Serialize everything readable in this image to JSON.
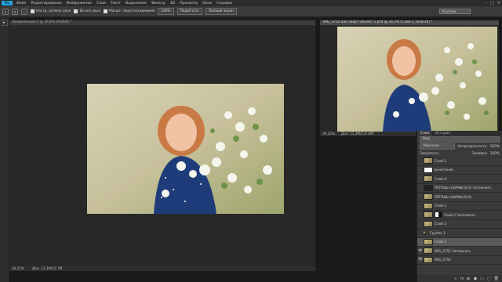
{
  "app": {
    "logo": "Ps"
  },
  "menu": [
    "Файл",
    "Редактирование",
    "Изображение",
    "Слои",
    "Текст",
    "Выделение",
    "Фильтр",
    "3D",
    "Просмотр",
    "Окно",
    "Справка"
  ],
  "window_controls": {
    "min": "–",
    "max": "□",
    "close": "✕"
  },
  "options": {
    "zoom_in": "+",
    "zoom_out": "−",
    "resize_windows": "Настр. размер окон",
    "all_windows": "Во все окна",
    "scrubby_zoom": "Масшт. перетаскиванием",
    "zoom_pct": "100%",
    "fit_screen": "Подогнать",
    "fill_screen": "Полный экран",
    "workspace": "Коллаж"
  },
  "toolbar": {
    "arrow": "▸"
  },
  "doc1": {
    "tab": "Безымянный-1 @ 36,2% (RGB/8) *",
    "zoom": "36,22%",
    "size": "Док: 11,3М/22,7М"
  },
  "doc2": {
    "tab": "IMG_3752 как смарт-объект-1.psd @ 36,2% (Слой 1, RGB/16) *",
    "zoom": "36,22%",
    "size": "Док: 11,3М/237,6М"
  },
  "layers_panel": {
    "tabs": [
      "Слои",
      "История"
    ],
    "kind": "Вид",
    "blend": "Обычные",
    "opacity_label": "Непрозрачность:",
    "opacity": "100%",
    "lock_label": "Закрепить:",
    "fill_label": "Заливка:",
    "fill": "100%",
    "layers": [
      {
        "name": "Слой 5",
        "thumb": "photo",
        "mask": false,
        "visible": false,
        "active": false
      },
      {
        "name": "вычитание",
        "thumb": "white",
        "mask": false,
        "visible": false,
        "active": false
      },
      {
        "name": "Слой 4",
        "thumb": "photo",
        "mask": false,
        "visible": false,
        "active": false
      },
      {
        "name": "РЕТУШЬ+ШУМЫ(3)(3) Затемнить",
        "thumb": "dark",
        "mask": false,
        "visible": false,
        "active": false
      },
      {
        "name": "РЕТУШЬ+ШУМЫ(3)(3)",
        "thumb": "photo",
        "mask": false,
        "visible": false,
        "active": false
      },
      {
        "name": "Слой 3",
        "thumb": "photo",
        "mask": false,
        "visible": false,
        "active": false
      },
      {
        "name": "Слой 2 Затемнить",
        "thumb": "photo",
        "mask": true,
        "visible": false,
        "active": false
      },
      {
        "name": "Слой 2",
        "thumb": "photo",
        "mask": false,
        "visible": false,
        "active": false
      },
      {
        "name": "Группа 1",
        "thumb": "folder",
        "mask": false,
        "visible": false,
        "active": false
      },
      {
        "name": "Слой 1",
        "thumb": "photo",
        "mask": false,
        "visible": false,
        "active": true
      },
      {
        "name": "IMG_3752 Затемнить",
        "thumb": "photo",
        "mask": false,
        "visible": true,
        "active": false
      },
      {
        "name": "IMG_3752",
        "thumb": "photo",
        "mask": false,
        "visible": true,
        "active": false
      }
    ],
    "footer": [
      "∞",
      "fx",
      "◐",
      "●",
      "▭",
      "▢",
      "🗑"
    ]
  }
}
